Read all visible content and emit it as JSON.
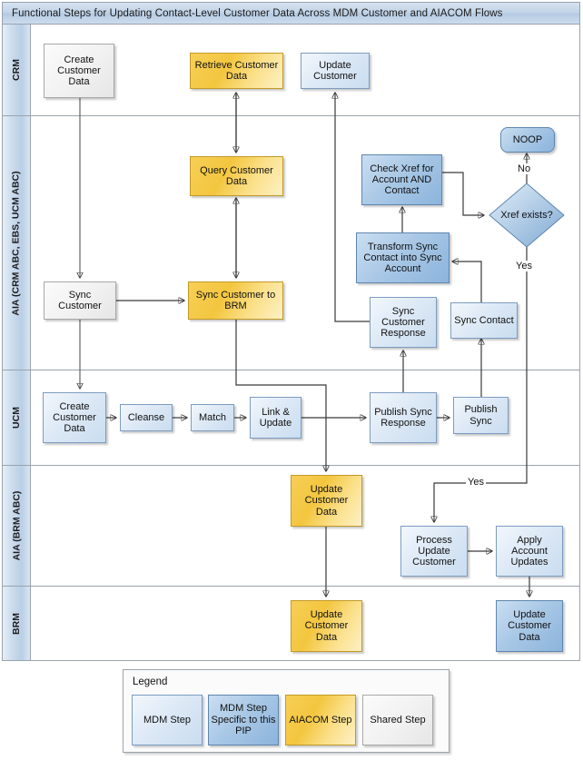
{
  "title": "Functional Steps for Updating Contact-Level Customer Data Across MDM Customer and AIACOM Flows",
  "lanes": [
    {
      "id": "crm",
      "label": "CRM"
    },
    {
      "id": "aia_crm",
      "label": "AIA (CRM ABC, EBS, UCM ABC)"
    },
    {
      "id": "ucm",
      "label": "UCM"
    },
    {
      "id": "aia_brm",
      "label": "AIA (BRM ABC)"
    },
    {
      "id": "brm",
      "label": "BRM"
    }
  ],
  "nodes": {
    "create_customer_data_crm": "Create Customer Data",
    "retrieve_customer_data": "Retrieve Customer Data",
    "update_customer_crm": "Update Customer",
    "query_customer_data": "Query Customer Data",
    "check_xref": "Check Xref for Account AND Contact",
    "noop": "NOOP",
    "xref_exists": "Xref exists?",
    "transform_sync_contact": "Transform Sync Contact into Sync Account",
    "sync_customer": "Sync Customer",
    "sync_customer_to_brm": "Sync Customer to BRM",
    "sync_customer_response": "Sync Customer Response",
    "sync_contact": "Sync Contact",
    "create_customer_data_ucm": "Create Customer Data",
    "cleanse": "Cleanse",
    "match": "Match",
    "link_update": "Link & Update",
    "publish_sync_response": "Publish Sync Response",
    "publish_sync": "Publish Sync",
    "update_customer_data_aia_brm": "Update Customer Data",
    "process_update_customer": "Process Update Customer",
    "apply_account_updates": "Apply Account Updates",
    "update_customer_data_brm_left": "Update Customer Data",
    "update_customer_data_brm_right": "Update Customer Data"
  },
  "edge_labels": {
    "no": "No",
    "yes_top": "Yes",
    "yes_bottom": "Yes"
  },
  "legend": {
    "title": "Legend",
    "items": [
      {
        "label": "MDM Step",
        "style": "mdm",
        "color": "#dde9f6"
      },
      {
        "label": "MDM Step Specific to this PIP",
        "style": "mdm-pip",
        "color": "#a9c8e6"
      },
      {
        "label": "AIACOM Step",
        "style": "aiacom",
        "color": "#f3c63f"
      },
      {
        "label": "Shared Step",
        "style": "shared",
        "color": "#f1f1f1"
      }
    ]
  }
}
